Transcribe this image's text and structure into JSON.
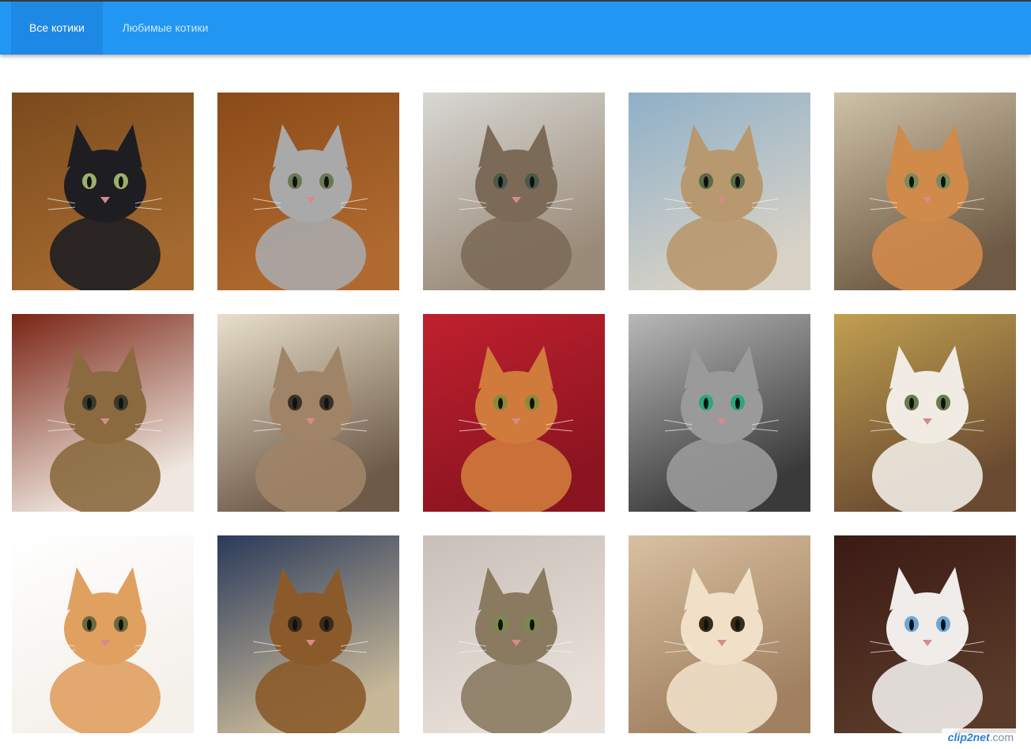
{
  "nav": {
    "tabs": [
      {
        "label": "Все котики",
        "active": true
      },
      {
        "label": "Любимые котики",
        "active": false
      }
    ],
    "accent": "#2196f3",
    "active_bg": "#1e88e5"
  },
  "gallery": {
    "columns": 5,
    "rows": 3,
    "cats": [
      {
        "bg1": "#7a4a1c",
        "bg2": "#a46a30",
        "fur": "#1e1e22",
        "eye": "#9bb06a"
      },
      {
        "bg1": "#8a4a18",
        "bg2": "#b06a30",
        "fur": "#a9a9aa",
        "eye": "#6a7a50"
      },
      {
        "bg1": "#d8d8d4",
        "bg2": "#9a8a78",
        "fur": "#7b6a58",
        "eye": "#4a5a48"
      },
      {
        "bg1": "#8eb0c8",
        "bg2": "#d8d2c6",
        "fur": "#b8986e",
        "eye": "#5a6a48"
      },
      {
        "bg1": "#cfc2a8",
        "bg2": "#6e5a44",
        "fur": "#d08a4a",
        "eye": "#7a8a5a"
      },
      {
        "bg1": "#7a2414",
        "bg2": "#f0e8e0",
        "fur": "#8a6a3e",
        "eye": "#3a3a2a"
      },
      {
        "bg1": "#e8e0cc",
        "bg2": "#6e5a48",
        "fur": "#a08468",
        "eye": "#3a3028"
      },
      {
        "bg1": "#c0202e",
        "bg2": "#8a1420",
        "fur": "#d07a3c",
        "eye": "#8a8a3a"
      },
      {
        "bg1": "#b8b8b8",
        "bg2": "#3a3a3a",
        "fur": "#9a9a9a",
        "eye": "#2aa878"
      },
      {
        "bg1": "#c0a050",
        "bg2": "#6a4a30",
        "fur": "#f0ece4",
        "eye": "#6a7a4a"
      },
      {
        "bg1": "#ffffff",
        "bg2": "#f4f0ea",
        "fur": "#e0a060",
        "eye": "#6a6a3a"
      },
      {
        "bg1": "#2a3a5a",
        "bg2": "#c8b898",
        "fur": "#8a5a2a",
        "eye": "#3a2a1a"
      },
      {
        "bg1": "#c8c0b8",
        "bg2": "#e8e0d8",
        "fur": "#8a7a60",
        "eye": "#7a8a4a"
      },
      {
        "bg1": "#d8c0a0",
        "bg2": "#a08060",
        "fur": "#f0e0c8",
        "eye": "#3a2a1a"
      },
      {
        "bg1": "#3a1a14",
        "bg2": "#5a3a28",
        "fur": "#f0ecea",
        "eye": "#6aa8d8"
      }
    ]
  },
  "watermark": {
    "brand": "clip2net",
    "suffix": ".com"
  }
}
